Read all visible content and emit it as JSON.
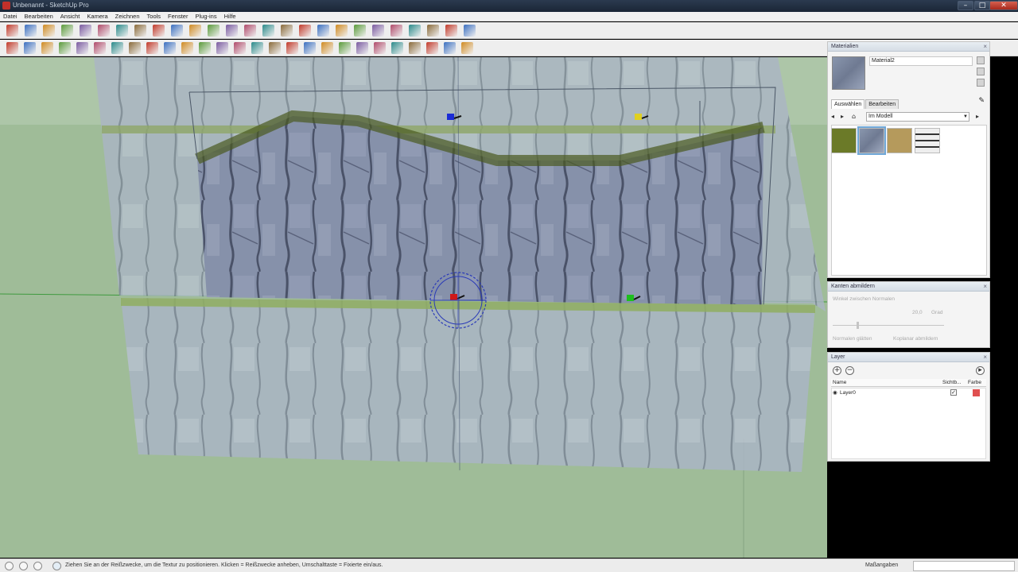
{
  "window": {
    "title": "Unbenannt - SketchUp Pro",
    "controls": [
      "–",
      "□",
      "✕"
    ]
  },
  "menu": [
    "Datei",
    "Bearbeiten",
    "Ansicht",
    "Kamera",
    "Zeichnen",
    "Tools",
    "Fenster",
    "Plug-ins",
    "Hilfe"
  ],
  "toolbar_icons": {
    "row1": [
      "select",
      "pencil",
      "rectangle",
      "circle",
      "arc",
      "eraser",
      "paint-bucket",
      "push-pull",
      "move",
      "rotate",
      "offset",
      "orbit",
      "pan",
      "zoom",
      "zoom-extents",
      "previous-view",
      "next-view",
      "components",
      "paint",
      "measure",
      "camera",
      "views",
      "section",
      "shadows",
      "styles",
      "layers"
    ],
    "row2": [
      "select",
      "line",
      "freehand",
      "rectangle",
      "circle",
      "polygon",
      "arc",
      "move",
      "push-pull",
      "rotate",
      "follow-me",
      "scale",
      "offset",
      "tape-measure",
      "dimension",
      "protractor",
      "text",
      "axes",
      "3d-text",
      "orbit",
      "pan",
      "zoom",
      "zoom-window",
      "zoom-extents",
      "walk",
      "look-around",
      "position-camera"
    ]
  },
  "materials_panel": {
    "title": "Materialien",
    "current_material": "Material2",
    "tabs": [
      "Auswählen",
      "Bearbeiten"
    ],
    "active_tab": "Auswählen",
    "collection": "Im Modell",
    "swatches": [
      {
        "name": "grass",
        "color": "#6b7a28"
      },
      {
        "name": "rock-texture",
        "color": "#8a95ad"
      },
      {
        "name": "sand",
        "color": "#b59a5c"
      },
      {
        "name": "edge-style",
        "color": "#e8e8e8"
      }
    ]
  },
  "edges_panel": {
    "title": "Kanten abmildern",
    "angle_label": "Winkel zwischen Normalen",
    "angle_value": "20,0",
    "angle_unit": "Grad",
    "smooth_normals": "Normalen glätten",
    "soften_coplanar": "Koplanar abmildern"
  },
  "layers_panel": {
    "title": "Layer",
    "columns": [
      "Name",
      "Sichtb...",
      "Farbe"
    ],
    "rows": [
      {
        "name": "Layer0",
        "visible": true,
        "color": "#e05050"
      }
    ]
  },
  "status": {
    "text": "Ziehen Sie an der Reißzwecke, um die Textur zu positionieren. Klicken = Reißzwecke anheben, Umschalttaste = Fixierte ein/aus.",
    "measure_label": "Maßangaben",
    "measure_value": ""
  },
  "scene": {
    "sky_color": "#d8dfe8",
    "ground_color": "#9dbc96",
    "texture_pins": [
      "blue-pin",
      "yellow-pin",
      "red-pin",
      "green-pin"
    ]
  }
}
